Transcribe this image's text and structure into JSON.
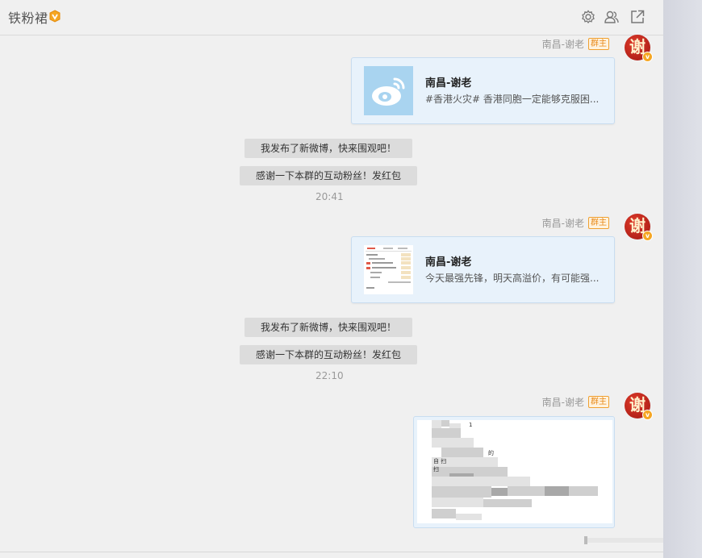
{
  "header": {
    "title": "铁粉裙",
    "icons": [
      "settings-icon",
      "members-icon",
      "popout-icon"
    ]
  },
  "messages": {
    "sender": "南昌-谢老",
    "role_badge": "群主",
    "avatar_char": "谢",
    "avatar_badge": "v",
    "card1": {
      "title": "南昌-谢老",
      "desc": "#香港火灾# 香港同胞一定能够克服困..."
    },
    "card2": {
      "title": "南昌-谢老",
      "desc": "今天最强先锋，明天高溢价，有可能强..."
    },
    "sys_posted": "我发布了新微博，快来围观吧！",
    "sys_thanks": "感谢一下本群的互动粉丝！发红包",
    "time1": "20:41",
    "time2": "22:10"
  },
  "colors": {
    "chat_bg": "#f0f0f0",
    "card_bg": "#e8f2fb",
    "role_badge": "#e88a1a",
    "avatar_red": "#c0251b"
  }
}
